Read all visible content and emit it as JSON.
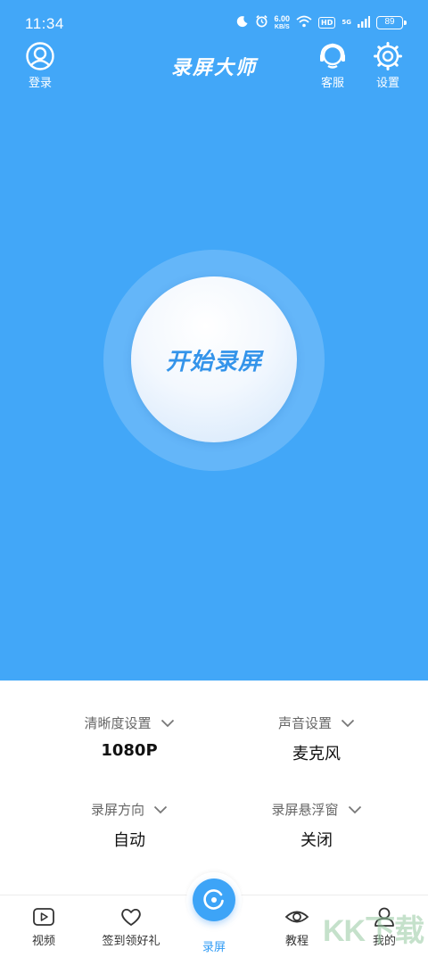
{
  "status_bar": {
    "time": "11:34",
    "speed_value": "6.00",
    "speed_unit": "KB/S",
    "hd": "HD",
    "network": "5G",
    "battery": "89"
  },
  "header": {
    "title": "录屏大师",
    "login_label": "登录",
    "service_label": "客服",
    "settings_label": "设置"
  },
  "record": {
    "label": "开始录屏"
  },
  "options": [
    {
      "label": "清晰度设置",
      "value": "1080P"
    },
    {
      "label": "声音设置",
      "value": "麦克风"
    },
    {
      "label": "录屏方向",
      "value": "自动"
    },
    {
      "label": "录屏悬浮窗",
      "value": "关闭"
    }
  ],
  "tabs": [
    {
      "label": "视频",
      "icon": "video-icon"
    },
    {
      "label": "签到领好礼",
      "icon": "heart-icon"
    },
    {
      "label": "录屏",
      "icon": "record-icon"
    },
    {
      "label": "教程",
      "icon": "eye-icon"
    },
    {
      "label": "我的",
      "icon": "user-icon"
    }
  ],
  "watermark": "KK下载",
  "colors": {
    "primary": "#42a7f8",
    "accent": "#3494ea",
    "tab_active": "#2f9bf5"
  }
}
